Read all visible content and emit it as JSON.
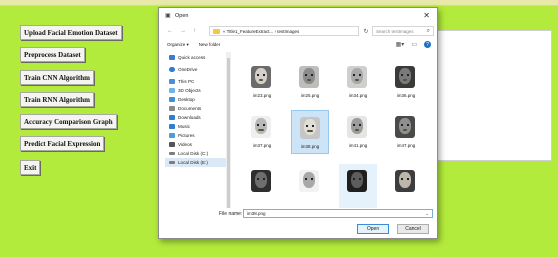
{
  "app": {
    "buttons": [
      {
        "label": "Upload Facial Emotion Dataset"
      },
      {
        "label": "Preprocess Dataset"
      },
      {
        "label": "Train CNN Algorithm"
      },
      {
        "label": "Train RNN Algorithm"
      },
      {
        "label": "Accuracy Comparison Graph"
      },
      {
        "label": "Predict Facial Expression"
      },
      {
        "label": "Exit"
      }
    ]
  },
  "dialog": {
    "title": "Open",
    "breadcrumb": "« Title1_FeatureExtract... › testImages",
    "search_placeholder": "Search testImages",
    "organize_label": "Organize ▾",
    "new_folder_label": "New folder",
    "nav_items": [
      {
        "label": "Quick access",
        "icon": "star-icon",
        "color": "#3a7bd5"
      },
      {
        "label": "OneDrive",
        "icon": "cloud-icon",
        "color": "#2b7cd3"
      },
      {
        "label": "This PC",
        "icon": "computer-icon",
        "color": "#4a90d9"
      },
      {
        "label": "3D Objects",
        "icon": "cube-icon",
        "color": "#6fb3e8"
      },
      {
        "label": "Desktop",
        "icon": "desktop-icon",
        "color": "#3d8fd8"
      },
      {
        "label": "Documents",
        "icon": "documents-icon",
        "color": "#8a8a8a"
      },
      {
        "label": "Downloads",
        "icon": "download-icon",
        "color": "#2f7fd0"
      },
      {
        "label": "Music",
        "icon": "music-icon",
        "color": "#2f7fd0"
      },
      {
        "label": "Pictures",
        "icon": "pictures-icon",
        "color": "#4f9be0"
      },
      {
        "label": "Videos",
        "icon": "videos-icon",
        "color": "#555"
      },
      {
        "label": "Local Disk (C:)",
        "icon": "disk-icon",
        "color": "#7d7d7d"
      },
      {
        "label": "Local Disk (E:)",
        "icon": "disk-icon",
        "color": "#7d7d7d"
      }
    ],
    "files": [
      {
        "name": "im23.png"
      },
      {
        "name": "im25.png"
      },
      {
        "name": "im34.png"
      },
      {
        "name": "im36.png"
      },
      {
        "name": "im37.png"
      },
      {
        "name": "im38.png"
      },
      {
        "name": "im41.png"
      },
      {
        "name": "im47.png"
      },
      {
        "name": ""
      },
      {
        "name": ""
      },
      {
        "name": ""
      },
      {
        "name": ""
      }
    ],
    "file_name_label": "File name:",
    "file_name_value": "im38.png",
    "open_label": "Open",
    "cancel_label": "Cancel"
  }
}
